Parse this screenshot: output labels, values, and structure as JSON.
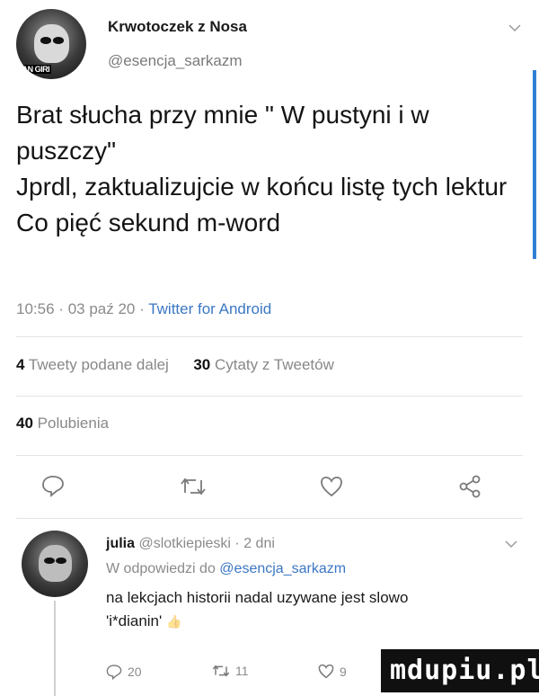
{
  "tweet": {
    "author_name": "Krwotoczek z Nosa",
    "author_handle": "@esencja_sarkazm",
    "avatar_badge": "AN GIRI",
    "text": "Brat słucha przy mnie \" W pustyni i w puszczy\"\nJprdl, zaktualizujcie w końcu listę tych lektur\nCo pięć sekund m-word",
    "time": "10:56",
    "date": "03 paź 20",
    "separator": "·",
    "client": "Twitter for Android"
  },
  "stats": {
    "retweets_count": "4",
    "retweets_label": "Tweety podane dalej",
    "quotes_count": "30",
    "quotes_label": "Cytaty z Tweetów",
    "likes_count": "40",
    "likes_label": "Polubienia"
  },
  "actions": [
    "reply-icon",
    "retweet-icon",
    "like-icon",
    "share-icon"
  ],
  "reply": {
    "author_name": "julia",
    "author_handle": "@slotkiepieski",
    "age": "2 dni",
    "replying_prefix": "W odpowiedzi do",
    "replying_to": "@esencja_sarkazm",
    "text_line1": "na lekcjach historii nadal uzywane jest slowo",
    "text_line2": "'i*dianin'",
    "emoji": "👍",
    "reply_count": "20",
    "retweet_count": "11",
    "like_count": "9"
  },
  "watermark": "mdupiu.pl",
  "colors": {
    "link": "#3b77c4",
    "muted": "#8a8a8a",
    "scrollbar": "#2f7fd6"
  }
}
